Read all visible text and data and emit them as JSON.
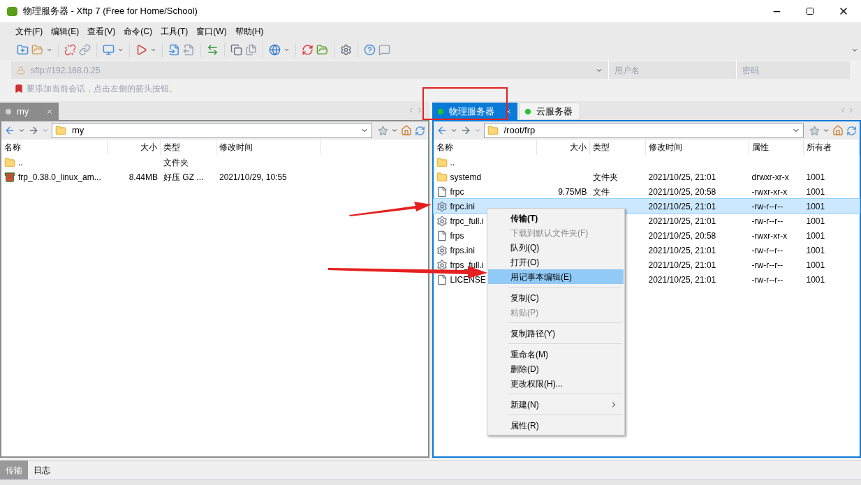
{
  "window": {
    "title": "物理服务器 - Xftp 7 (Free for Home/School)"
  },
  "menu": [
    "文件(F)",
    "编辑(E)",
    "查看(V)",
    "命令(C)",
    "工具(T)",
    "窗口(W)",
    "帮助(H)"
  ],
  "address": {
    "value": "sftp://192.168.0.25",
    "user_placeholder": "用户名",
    "password_placeholder": "密码"
  },
  "hint": "要添加当前会话，点击左侧的箭头按钮。",
  "panes": [
    {
      "active": false,
      "tabs": [
        {
          "label": "my",
          "selected": true,
          "connected": false
        }
      ],
      "path": "my",
      "columns": [
        {
          "label": "名称"
        },
        {
          "label": "大小"
        },
        {
          "label": "类型"
        },
        {
          "label": "修改时间"
        }
      ],
      "rows": [
        {
          "kind": "folder",
          "selected": false,
          "name": "..",
          "type": "文件夹"
        },
        {
          "kind": "archive",
          "selected": false,
          "name": "frp_0.38.0_linux_am...",
          "size": "8.44MB",
          "type": "好压 GZ ...",
          "modified": "2021/10/29, 10:55"
        }
      ]
    },
    {
      "active": true,
      "tabs": [
        {
          "label": "物理服务器",
          "selected": true,
          "connected": true
        },
        {
          "label": "云服务器",
          "selected": false,
          "connected": true
        }
      ],
      "path": "/root/frp",
      "columns": [
        {
          "label": "名称"
        },
        {
          "label": "大小"
        },
        {
          "label": "类型"
        },
        {
          "label": "修改时间"
        },
        {
          "label": "属性"
        },
        {
          "label": "所有者"
        }
      ],
      "rows": [
        {
          "kind": "folder",
          "selected": false,
          "name": ".."
        },
        {
          "kind": "folder",
          "selected": false,
          "name": "systemd",
          "type": "文件夹",
          "modified": "2021/10/25, 21:01",
          "attrs": "drwxr-xr-x",
          "owner": "1001"
        },
        {
          "kind": "file",
          "selected": false,
          "name": "frpc",
          "size": "9.75MB",
          "type": "文件",
          "modified": "2021/10/25, 20:58",
          "attrs": "-rwxr-xr-x",
          "owner": "1001"
        },
        {
          "kind": "config",
          "selected": true,
          "name": "frpc.ini",
          "modified": "2021/10/25, 21:01",
          "attrs": "-rw-r--r--",
          "owner": "1001"
        },
        {
          "kind": "config",
          "selected": false,
          "name": "frpc_full.i",
          "modified": "2021/10/25, 21:01",
          "attrs": "-rw-r--r--",
          "owner": "1001"
        },
        {
          "kind": "file",
          "selected": false,
          "name": "frps",
          "modified": "2021/10/25, 20:58",
          "attrs": "-rwxr-xr-x",
          "owner": "1001"
        },
        {
          "kind": "config",
          "selected": false,
          "name": "frps.ini",
          "modified": "2021/10/25, 21:01",
          "attrs": "-rw-r--r--",
          "owner": "1001"
        },
        {
          "kind": "config",
          "selected": false,
          "name": "frps_full.i",
          "modified": "2021/10/25, 21:01",
          "attrs": "-rw-r--r--",
          "owner": "1001"
        },
        {
          "kind": "file",
          "selected": false,
          "name": "LICENSE",
          "modified": "2021/10/25, 21:01",
          "attrs": "-rw-r--r--",
          "owner": "1001"
        }
      ]
    }
  ],
  "context_menu": [
    {
      "kind": "item",
      "label": "传输(T)",
      "bold": true,
      "disabled": false,
      "selected": false
    },
    {
      "kind": "item",
      "label": "下载到默认文件夹(F)",
      "bold": false,
      "disabled": true,
      "selected": false
    },
    {
      "kind": "item",
      "label": "队列(Q)",
      "bold": false,
      "disabled": false,
      "selected": false
    },
    {
      "kind": "item",
      "label": "打开(O)",
      "bold": false,
      "disabled": false,
      "selected": false
    },
    {
      "kind": "item",
      "label": "用记事本编辑(E)",
      "bold": false,
      "disabled": false,
      "selected": true
    },
    {
      "kind": "separator"
    },
    {
      "kind": "item",
      "label": "复制(C)",
      "bold": false,
      "disabled": false,
      "selected": false
    },
    {
      "kind": "item",
      "label": "粘贴(P)",
      "bold": false,
      "disabled": true,
      "selected": false
    },
    {
      "kind": "separator"
    },
    {
      "kind": "item",
      "label": "复制路径(Y)",
      "bold": false,
      "disabled": false,
      "selected": false
    },
    {
      "kind": "separator"
    },
    {
      "kind": "item",
      "label": "重命名(M)",
      "bold": false,
      "disabled": false,
      "selected": false
    },
    {
      "kind": "item",
      "label": "删除(D)",
      "bold": false,
      "disabled": false,
      "selected": false
    },
    {
      "kind": "item",
      "label": "更改权限(H)...",
      "bold": false,
      "disabled": false,
      "selected": false
    },
    {
      "kind": "separator"
    },
    {
      "kind": "submenu",
      "label": "新建(N)",
      "bold": false,
      "disabled": false,
      "selected": false
    },
    {
      "kind": "separator"
    },
    {
      "kind": "item",
      "label": "属性(R)",
      "bold": false,
      "disabled": false,
      "selected": false
    }
  ],
  "bottom_tabs": [
    {
      "label": "传输",
      "selected": true
    },
    {
      "label": "日志",
      "selected": false
    }
  ]
}
